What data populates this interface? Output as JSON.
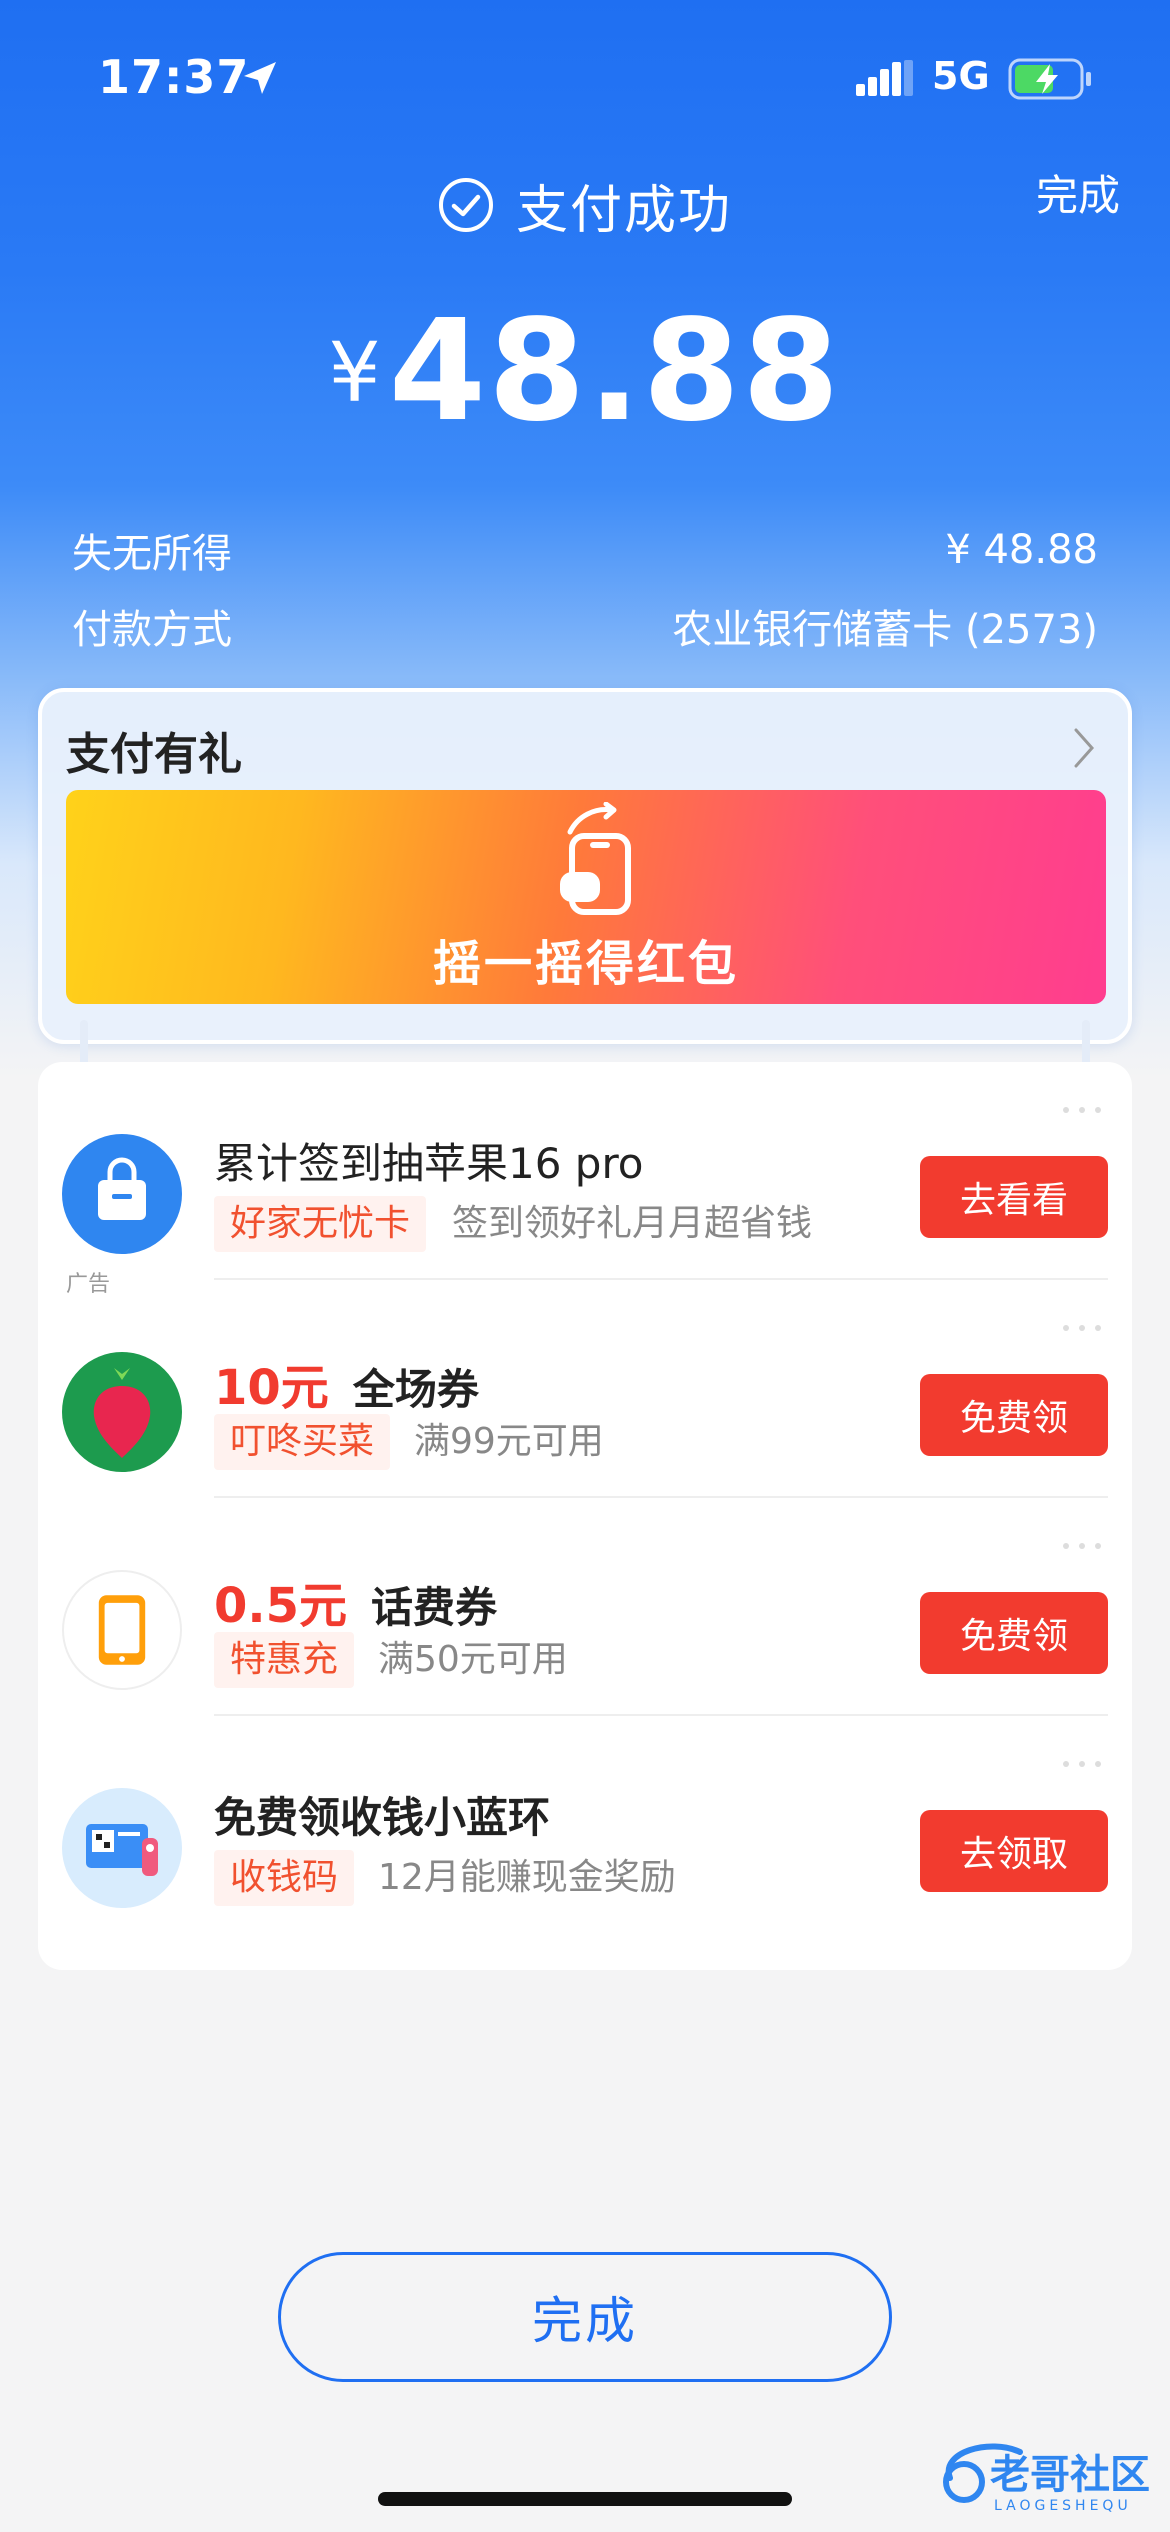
{
  "status_bar": {
    "time": "17:37",
    "network": "5G"
  },
  "header": {
    "done_label": "完成",
    "title": "支付成功"
  },
  "payment": {
    "currency_symbol": "¥",
    "amount": "48.88",
    "merchant_label": "失无所得",
    "merchant_amount": "¥ 48.88",
    "method_label": "付款方式",
    "method_value": "农业银行储蓄卡 (2573)"
  },
  "gift": {
    "title": "支付有礼",
    "banner_text": "摇一摇得红包"
  },
  "items": [
    {
      "title": "累计签到抽苹果16 pro",
      "tag": "好家无忧卡",
      "desc": "签到领好礼月月超省钱",
      "button": "去看看",
      "ad": "广告",
      "icon": "shopping-bag-icon"
    },
    {
      "title_red": "10元",
      "title": "全场券",
      "tag": "叮咚买菜",
      "desc": "满99元可用",
      "button": "免费领",
      "icon": "radish-icon"
    },
    {
      "title_red": "0.5元",
      "title": "话费券",
      "tag": "特惠充",
      "desc": "满50元可用",
      "button": "免费领",
      "icon": "phone-icon"
    },
    {
      "title": "免费领收钱小蓝环",
      "tag": "收钱码",
      "desc": "12月能赚现金奖励",
      "button": "去领取",
      "icon": "qr-card-icon"
    }
  ],
  "bottom": {
    "done_label": "完成"
  },
  "watermark": {
    "text": "老哥社区",
    "sub": "LAOGESHEQU"
  },
  "colors": {
    "primary_blue": "#1f6ff2",
    "action_red": "#f23b2f",
    "tag_text": "#f1512f"
  }
}
